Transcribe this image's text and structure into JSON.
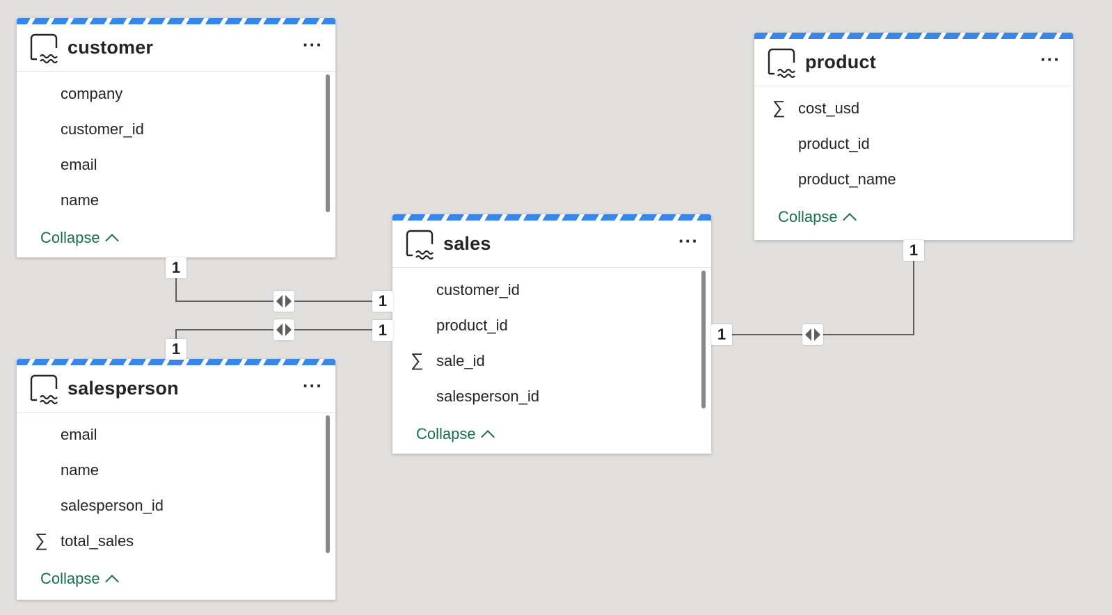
{
  "tables": {
    "customer": {
      "name": "customer",
      "fields": [
        {
          "name": "company",
          "sigma": false
        },
        {
          "name": "customer_id",
          "sigma": false
        },
        {
          "name": "email",
          "sigma": false
        },
        {
          "name": "name",
          "sigma": false
        }
      ],
      "collapse_label": "Collapse"
    },
    "salesperson": {
      "name": "salesperson",
      "fields": [
        {
          "name": "email",
          "sigma": false
        },
        {
          "name": "name",
          "sigma": false
        },
        {
          "name": "salesperson_id",
          "sigma": false
        },
        {
          "name": "total_sales",
          "sigma": true
        }
      ],
      "collapse_label": "Collapse"
    },
    "sales": {
      "name": "sales",
      "fields": [
        {
          "name": "customer_id",
          "sigma": false
        },
        {
          "name": "product_id",
          "sigma": false
        },
        {
          "name": "sale_id",
          "sigma": true
        },
        {
          "name": "salesperson_id",
          "sigma": false
        }
      ],
      "collapse_label": "Collapse"
    },
    "product": {
      "name": "product",
      "fields": [
        {
          "name": "cost_usd",
          "sigma": true
        },
        {
          "name": "product_id",
          "sigma": false
        },
        {
          "name": "product_name",
          "sigma": false
        }
      ],
      "collapse_label": "Collapse"
    }
  },
  "more_icon": "ellipsis-icon",
  "sigma_symbol": "∑",
  "relationships": [
    {
      "from": "customer",
      "to": "sales",
      "from_cardinality": "1",
      "to_cardinality": "1",
      "cross_filter": "both"
    },
    {
      "from": "salesperson",
      "to": "sales",
      "from_cardinality": "1",
      "to_cardinality": "1",
      "cross_filter": "both"
    },
    {
      "from": "product",
      "to": "sales",
      "from_cardinality": "1",
      "to_cardinality": "1",
      "cross_filter": "both"
    }
  ],
  "colors": {
    "accent": "#3a86e8",
    "collapse_text": "#1b6b52",
    "canvas": "#e1e0df",
    "connector": "#605e5c"
  }
}
